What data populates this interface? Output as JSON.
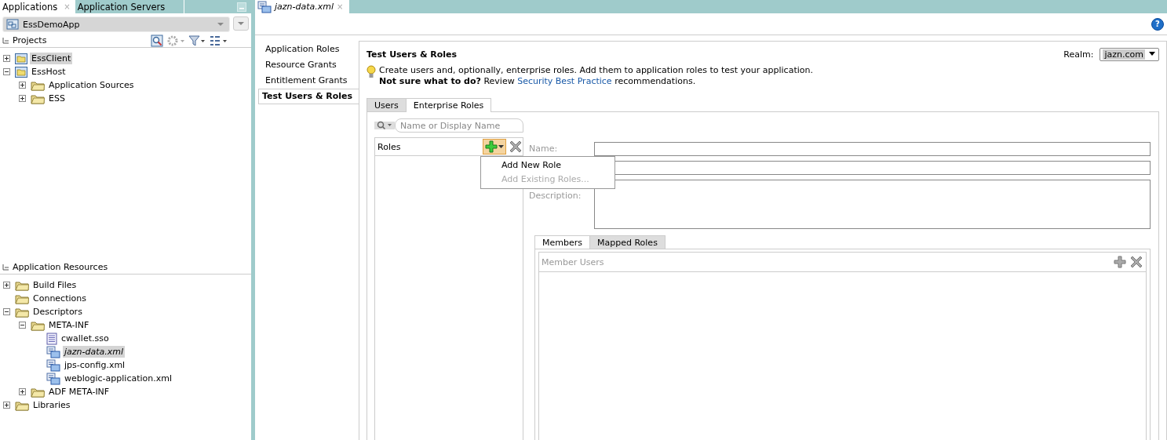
{
  "sidebar": {
    "tabs": [
      {
        "label": "Applications",
        "selected": true,
        "close": "×"
      },
      {
        "label": "Application Servers",
        "selected": false
      }
    ],
    "app_selector": {
      "value": "EssDemoApp"
    },
    "projects": {
      "title": "Projects",
      "tree": [
        {
          "label": "EssClient",
          "kind": "project",
          "selected": true,
          "expanded": false
        },
        {
          "label": "EssHost",
          "kind": "project",
          "selected": false,
          "expanded": true,
          "children": [
            {
              "label": "Application Sources",
              "kind": "folder",
              "selected": false,
              "expanded": false
            },
            {
              "label": "ESS",
              "kind": "folder",
              "selected": false,
              "expanded": false
            }
          ]
        }
      ]
    },
    "resources": {
      "title": "Application Resources",
      "tree": [
        {
          "label": "Build Files",
          "kind": "folder",
          "selected": false,
          "expanded": false
        },
        {
          "label": "Connections",
          "kind": "folder",
          "selected": false
        },
        {
          "label": "Descriptors",
          "kind": "folder",
          "selected": false,
          "expanded": true,
          "children": [
            {
              "label": "META-INF",
              "kind": "folder",
              "selected": false,
              "expanded": true,
              "children": [
                {
                  "label": "cwallet.sso",
                  "kind": "file",
                  "selected": false,
                  "open": false
                },
                {
                  "label": "jazn-data.xml",
                  "kind": "xml",
                  "selected": true,
                  "open": true
                },
                {
                  "label": "jps-config.xml",
                  "kind": "xml",
                  "selected": false,
                  "open": false
                },
                {
                  "label": "weblogic-application.xml",
                  "kind": "xml",
                  "selected": false,
                  "open": false
                }
              ]
            },
            {
              "label": "ADF META-INF",
              "kind": "folder",
              "selected": false,
              "expanded": false
            }
          ]
        },
        {
          "label": "Libraries",
          "kind": "folder",
          "selected": false,
          "expanded": false
        }
      ]
    }
  },
  "editor": {
    "tab": {
      "label": "jazn-data.xml",
      "close": "×"
    },
    "help": "?",
    "nav": [
      {
        "label": "Application Roles",
        "selected": false
      },
      {
        "label": "Resource Grants",
        "selected": false
      },
      {
        "label": "Entitlement Grants",
        "selected": false
      },
      {
        "label": "Test Users & Roles",
        "selected": true
      }
    ],
    "title": "Test Users & Roles",
    "realm": {
      "label": "Realm:",
      "value": "jazn.com"
    },
    "hint": "Create users and, optionally, enterprise roles. Add them to application roles to test your application.",
    "hint2": {
      "prefix": "**Not sure what to do?** Review",
      "link": "Security Best Practice",
      "suffix": "recommendations."
    },
    "tabs": [
      {
        "label": "Users",
        "selected": false
      },
      {
        "label": "Enterprise Roles",
        "selected": true
      }
    ],
    "search": {
      "placeholder": "Name or Display Name"
    },
    "roles_header": "Roles",
    "menu": [
      {
        "label": "Add New Role",
        "disabled": false
      },
      {
        "label": "Add Existing Roles...",
        "disabled": true
      }
    ],
    "fields": [
      {
        "label": "Name:",
        "kind": "line"
      },
      {
        "kind": "line"
      },
      {
        "label": "Description:",
        "kind": "area"
      }
    ],
    "member_tabs": [
      {
        "label": "Members",
        "selected": true
      },
      {
        "label": "Mapped Roles",
        "selected": false
      }
    ],
    "member_header": "Member Users"
  }
}
